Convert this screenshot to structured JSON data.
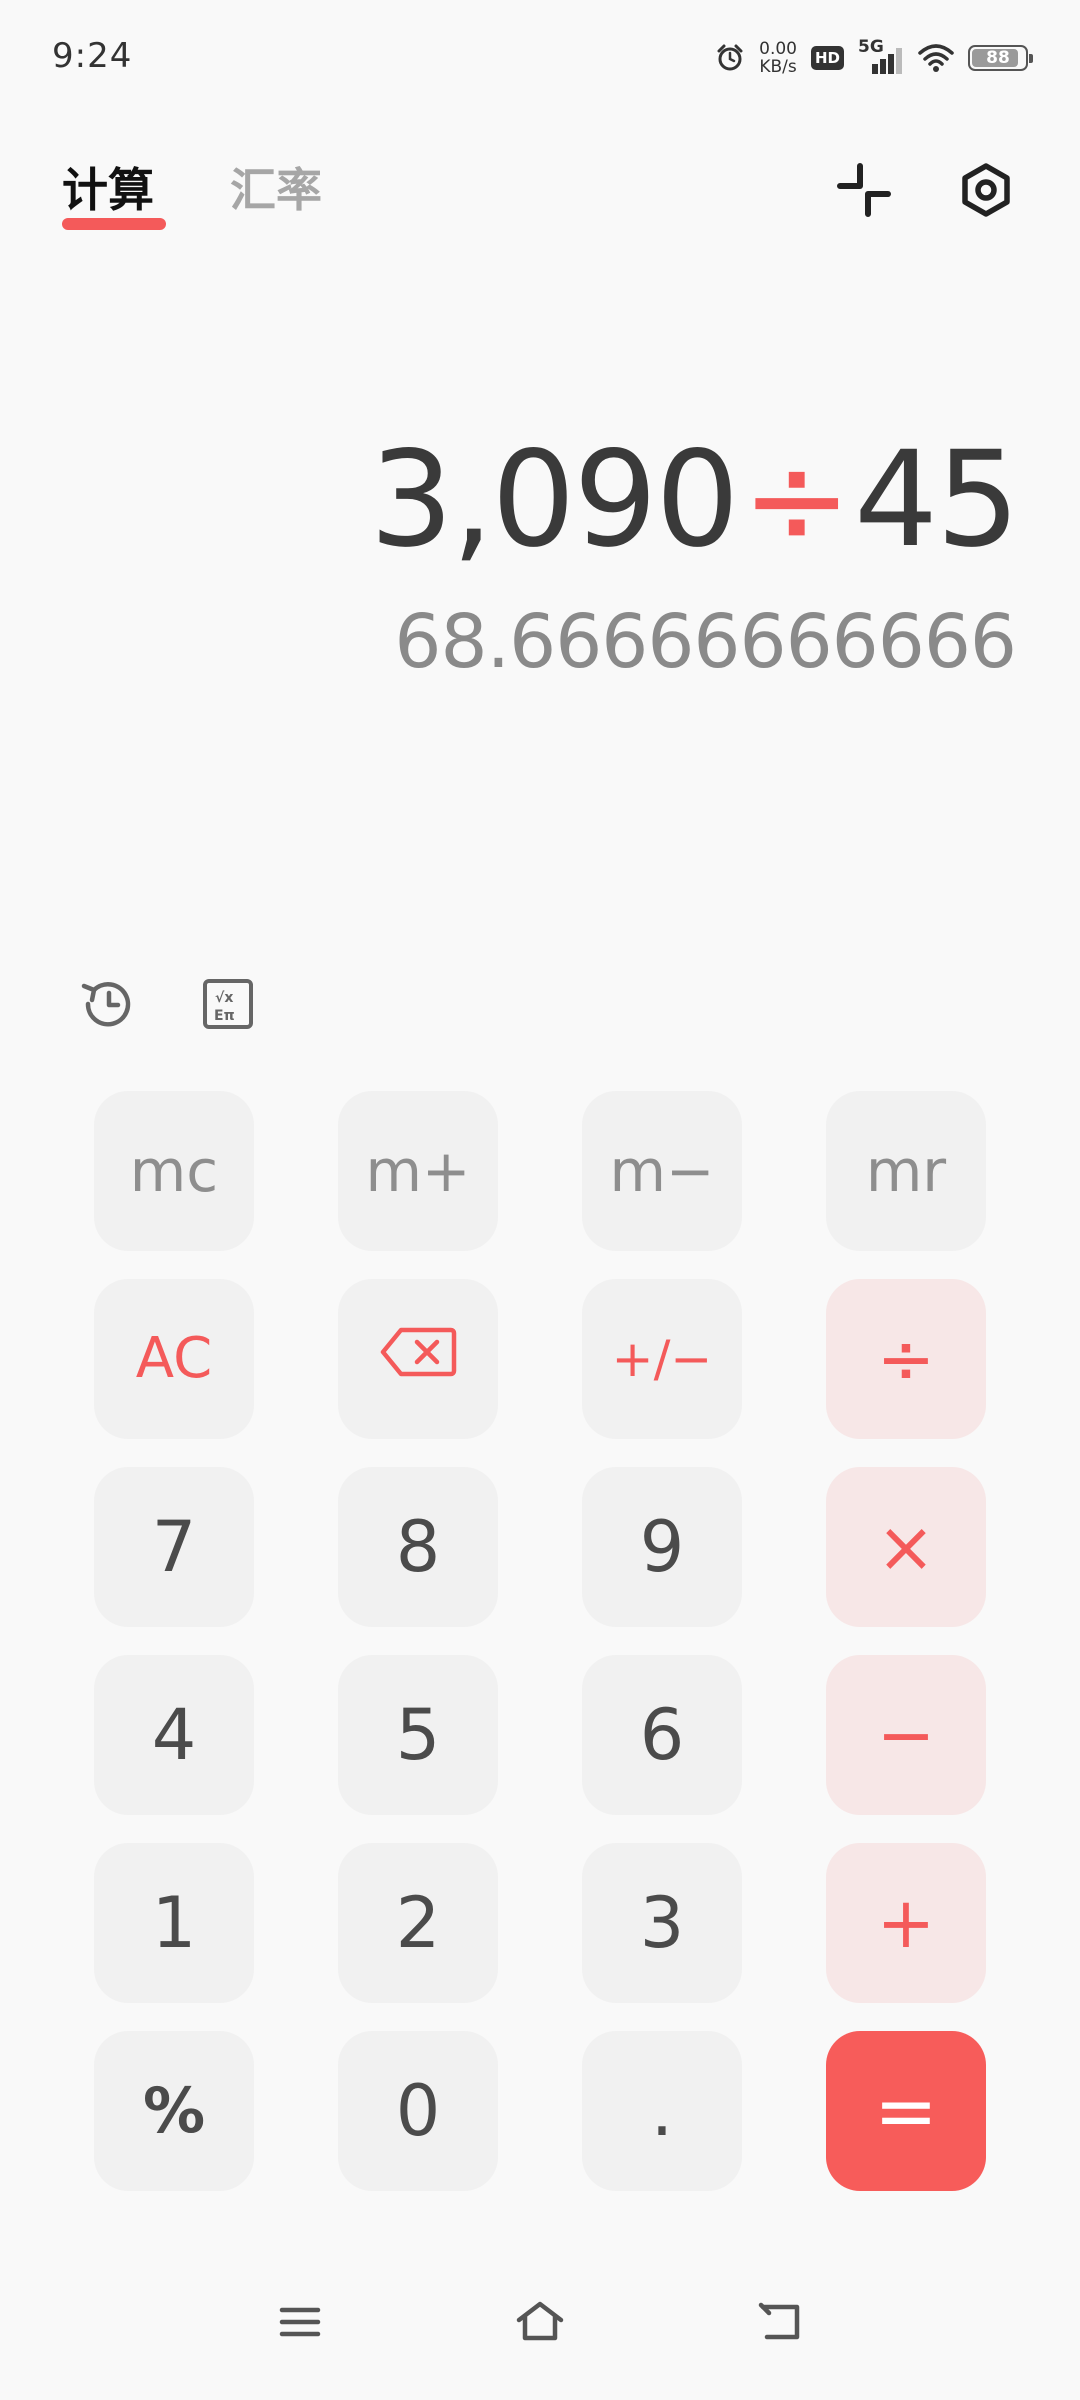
{
  "status_bar": {
    "time": "9:24",
    "net_speed_value": "0.00",
    "net_speed_unit": "KB/s",
    "hd_label": "HD",
    "network_label": "5G",
    "battery_level": "88",
    "battery_fraction": 0.88,
    "icons": [
      "alarm-icon",
      "hd-icon",
      "signal-5g-icon",
      "wifi-icon",
      "battery-icon"
    ]
  },
  "tabs": [
    {
      "label": "计算",
      "active": true
    },
    {
      "label": "汇率",
      "active": false
    }
  ],
  "header_icons": [
    "collapse-icon",
    "settings-icon"
  ],
  "display": {
    "operand1": "3,090",
    "operator": "÷",
    "operand2": "45",
    "result": "68.66666666666"
  },
  "tools": [
    "history-icon",
    "scientific-mode-icon"
  ],
  "keypad": {
    "row1": [
      "mc",
      "m+",
      "m−",
      "mr"
    ],
    "row2": [
      "AC",
      "backspace",
      "+/−",
      "÷"
    ],
    "row3": [
      "7",
      "8",
      "9",
      "×"
    ],
    "row4": [
      "4",
      "5",
      "6",
      "−"
    ],
    "row5": [
      "1",
      "2",
      "3",
      "+"
    ],
    "row6": [
      "%",
      "0",
      ".",
      "="
    ]
  },
  "nav_bar": [
    "menu-icon",
    "home-icon",
    "back-icon"
  ],
  "colors": {
    "accent": "#f45a5a",
    "equals_bg": "#f75c5a",
    "operator_bg": "#f7e7e7",
    "key_bg": "#f1f1f1",
    "background": "#f9f9f9"
  }
}
